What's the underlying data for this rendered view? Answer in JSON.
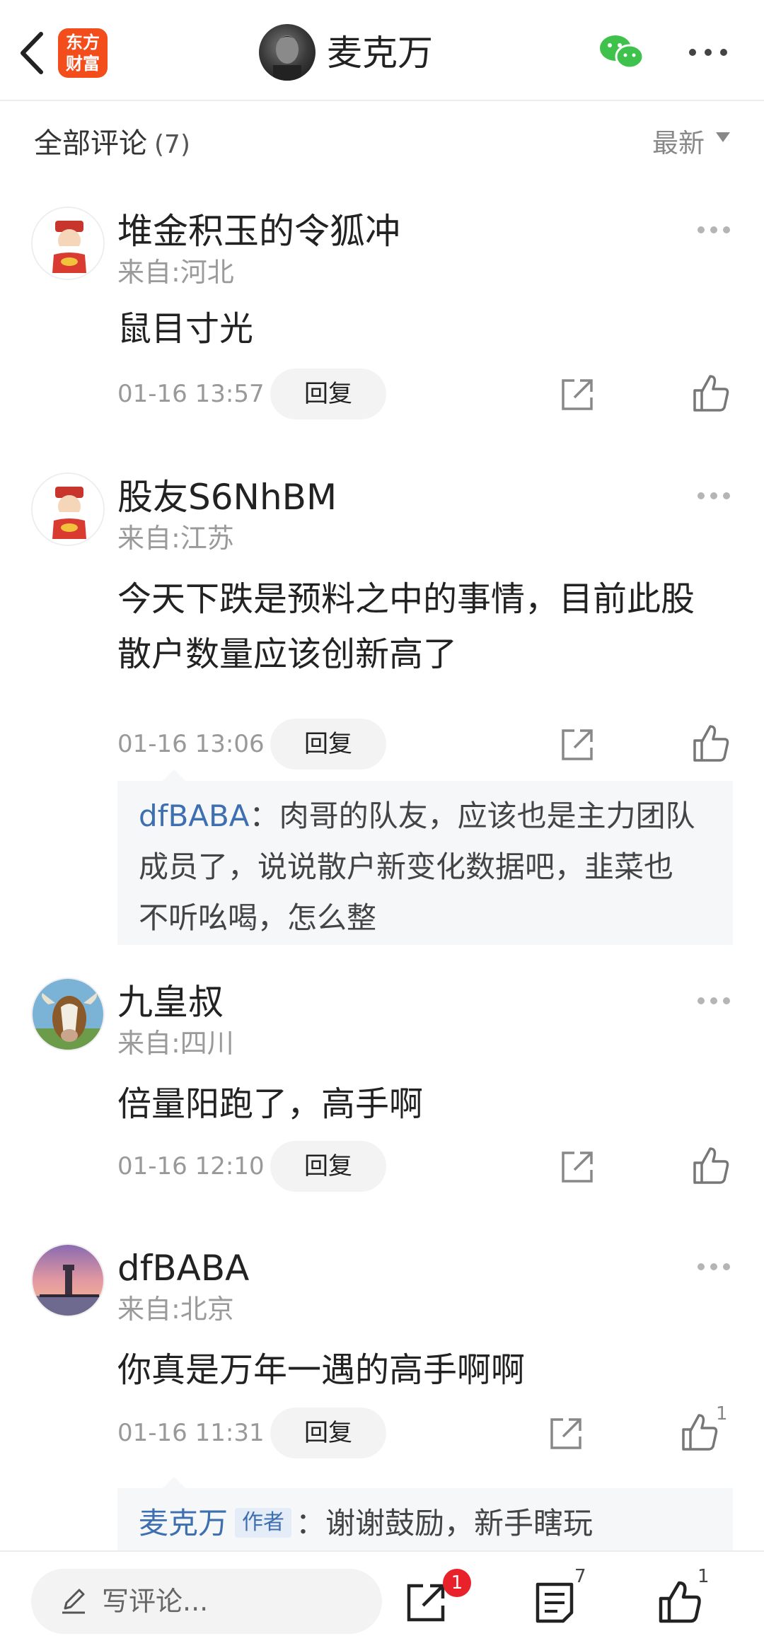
{
  "header": {
    "logo_line1": "东方",
    "logo_line2": "财富",
    "title": "麦克万"
  },
  "section": {
    "title": "全部评论",
    "count": "(7)",
    "sort_label": "最新"
  },
  "comments": [
    {
      "name": "堆金积玉的令狐冲",
      "location": "来自:河北",
      "text": "鼠目寸光",
      "time": "01-16 13:57",
      "reply_label": "回复",
      "like_count": ""
    },
    {
      "name": "股友S6NhBM",
      "location": "来自:江苏",
      "text_line1": "今天下跌是预料之中的事情，目前此股",
      "text_line2": "散户数量应该创新高了",
      "time": "01-16 13:06",
      "reply_label": "回复",
      "like_count": "",
      "sub_reply": {
        "user": "dfBABA",
        "sep": "：",
        "line1": "肉哥的队友，应该也是主力团队",
        "line2": "成员了，说说散户新变化数据吧，韭菜也",
        "line3": "不听吆喝，怎么整"
      }
    },
    {
      "name": "九皇叔",
      "location": "来自:四川",
      "text": "倍量阳跑了，高手啊",
      "time": "01-16 12:10",
      "reply_label": "回复",
      "like_count": ""
    },
    {
      "name": "dfBABA",
      "location": "来自:北京",
      "text": "你真是万年一遇的高手啊啊",
      "time": "01-16 11:31",
      "reply_label": "回复",
      "like_count": "1",
      "sub_reply": {
        "user": "麦克万",
        "tag": "作者",
        "sep": "：",
        "line1": "谢谢鼓励，新手瞎玩"
      }
    }
  ],
  "bottom_bar": {
    "write_placeholder": "写评论...",
    "share_badge": "1",
    "comments_count": "7",
    "likes_count": "1"
  },
  "colors": {
    "brand_orange": "#f24d1b",
    "link_blue": "#3d6fb1",
    "wechat_green": "#3fc24c",
    "badge_red": "#e8212b"
  },
  "icons": [
    "back-arrow-icon",
    "wechat-icon",
    "more-icon",
    "share-icon",
    "thumbs-up-icon",
    "pencil-icon",
    "list-icon"
  ]
}
